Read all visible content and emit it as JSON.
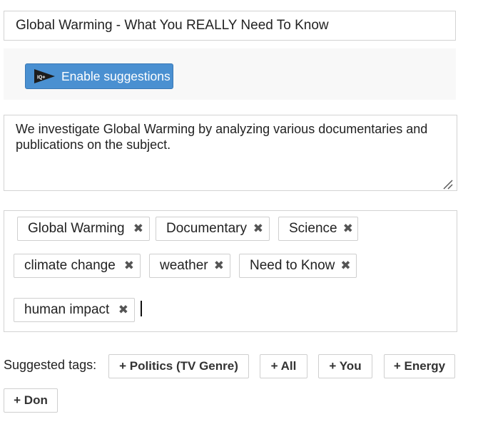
{
  "title_field": {
    "value": "Global Warming - What You REALLY Need To Know"
  },
  "suggestions": {
    "button_label": "Enable suggestions",
    "icon": "iq-play-icon",
    "icon_text": "IQ+"
  },
  "description": {
    "value": "We investigate Global Warming by analyzing various documentaries and publications on the subject."
  },
  "tags": [
    {
      "label": "Global Warming"
    },
    {
      "label": "Documentary"
    },
    {
      "label": "Science"
    },
    {
      "label": "climate change"
    },
    {
      "label": "weather"
    },
    {
      "label": "Need to Know"
    },
    {
      "label": "human impact"
    }
  ],
  "tag_remove_glyph": "✖",
  "suggested_tags": {
    "label": "Suggested tags:",
    "items": [
      "+ Politics (TV Genre)",
      "+ All",
      "+ You",
      "+ Energy",
      "+ Don"
    ]
  },
  "colors": {
    "accent_button": "#4a90d1",
    "border": "#d3d3d3"
  }
}
